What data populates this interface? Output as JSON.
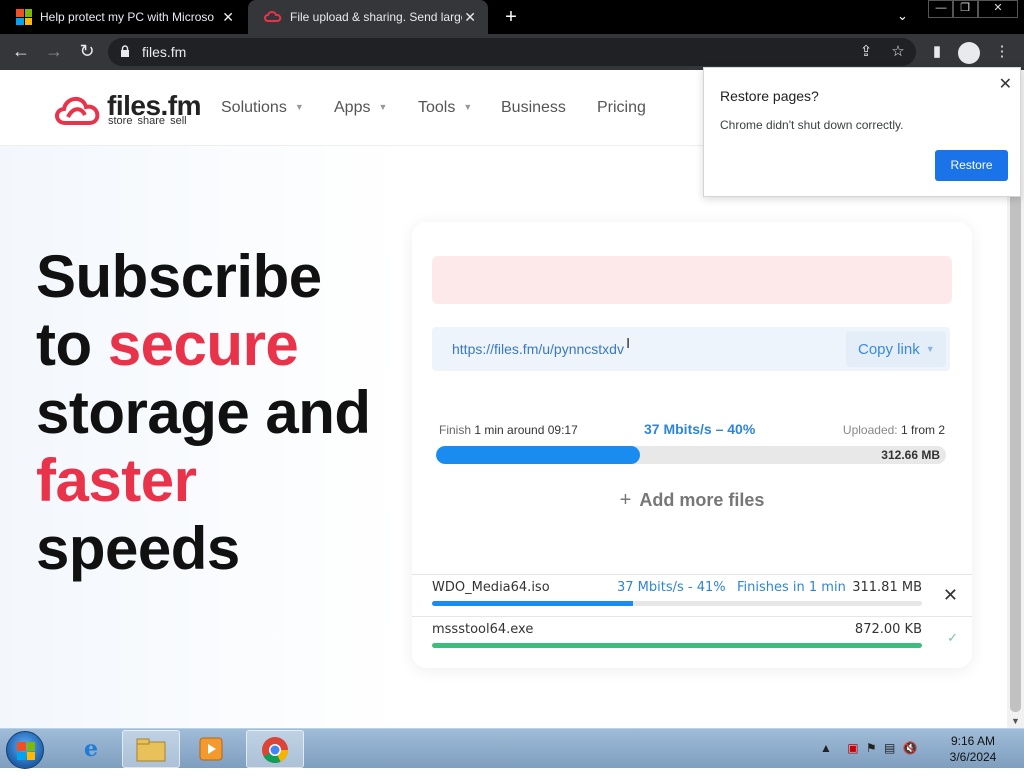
{
  "browser": {
    "tabs": [
      {
        "title": "Help protect my PC with Microso",
        "icon": "microsoft-logo"
      },
      {
        "title": "File upload & sharing. Send large",
        "icon": "files-fm-logo"
      }
    ],
    "new_tab_symbol": "+",
    "url": "files.fm"
  },
  "site": {
    "logo": "files.fm",
    "logo_sub": "store  share  sell",
    "nav": [
      "Solutions",
      "Apps",
      "Tools",
      "Business",
      "Pricing"
    ]
  },
  "hero": {
    "line1": "Subscribe",
    "line2a": "to ",
    "line2b": "secure",
    "line3": "storage and",
    "line4": "faster",
    "line5": "speeds",
    "accent_color": "#e8334a"
  },
  "upload": {
    "share_url": "https://files.fm/u/pynncstxdv",
    "copy_label": "Copy link",
    "finish_label": "Finish",
    "finish_value": "1 min around 09:17",
    "speed": "37 Mbits/s – 40%",
    "uploaded_label": "Uploaded:",
    "uploaded_value": "1 from 2",
    "progress": 0.4,
    "total_size": "312.66 MB",
    "add_more": "Add more files",
    "files": [
      {
        "name": "WDO_Media64.iso",
        "speed": "37 Mbits/s - 41%",
        "eta": "Finishes in 1 min",
        "size": "311.81 MB",
        "progress": 0.41,
        "color": "#1a8cf0",
        "status": "uploading"
      },
      {
        "name": "mssstool64.exe",
        "speed": "",
        "eta": "",
        "size": "872.00 KB",
        "progress": 1.0,
        "color": "#3dbd7d",
        "status": "done"
      }
    ]
  },
  "restore_popup": {
    "title": "Restore pages?",
    "message": "Chrome didn't shut down correctly.",
    "button": "Restore"
  },
  "taskbar": {
    "time": "9:16 AM",
    "date": "3/6/2024"
  }
}
